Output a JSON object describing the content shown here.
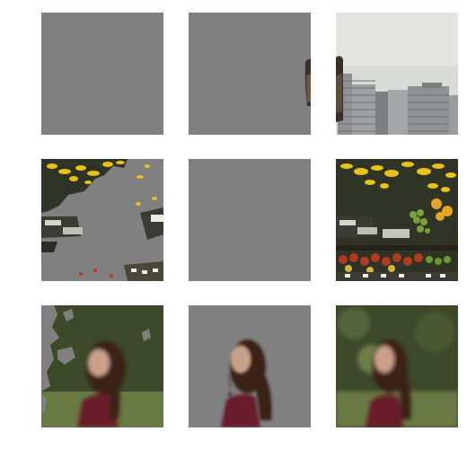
{
  "grid": {
    "rows": 3,
    "cols": 3,
    "tiles": [
      {
        "id": "r1c1",
        "scene": "city-buildings",
        "variant": "masked-background",
        "mask_color": "#808080"
      },
      {
        "id": "r1c2",
        "scene": "city-buildings",
        "variant": "masked-foreground",
        "mask_color": "#808080"
      },
      {
        "id": "r1c3",
        "scene": "city-buildings",
        "variant": "original"
      },
      {
        "id": "r2c1",
        "scene": "fruit-market",
        "variant": "masked-background",
        "mask_color": "#808080"
      },
      {
        "id": "r2c2",
        "scene": "fruit-market",
        "variant": "masked-foreground",
        "mask_color": "#808080"
      },
      {
        "id": "r2c3",
        "scene": "fruit-market",
        "variant": "original"
      },
      {
        "id": "r3c1",
        "scene": "woman-portrait",
        "variant": "masked-foreground",
        "mask_color": "#808080"
      },
      {
        "id": "r3c2",
        "scene": "woman-portrait",
        "variant": "masked-background",
        "mask_color": "#808080"
      },
      {
        "id": "r3c3",
        "scene": "woman-portrait",
        "variant": "original"
      }
    ]
  },
  "colors": {
    "mask_gray": "#808080",
    "sky": "#d9dbd6",
    "building": "#8e9193",
    "banana": "#e6c21a",
    "foliage": "#3d4a2a",
    "dress": "#6b1a2a"
  }
}
